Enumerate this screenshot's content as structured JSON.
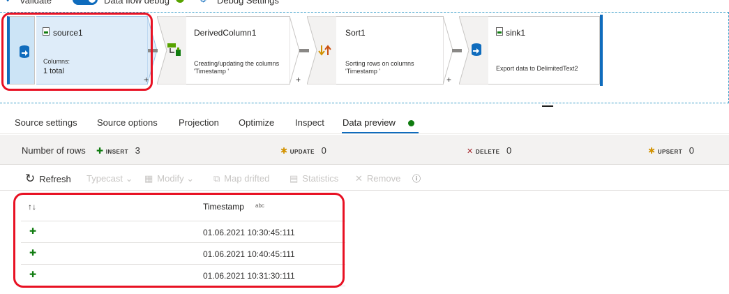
{
  "toolbar": {
    "validate_label": "Validate",
    "dataflow_debug_label": "Data flow debug",
    "debug_settings_label": "Debug Settings"
  },
  "nodes": [
    {
      "title": "source1",
      "desc_line1": "Columns:",
      "desc_line2": "1 total",
      "icon": "source-icon"
    },
    {
      "title": "DerivedColumn1",
      "desc_line1": "Creating/updating the columns",
      "desc_line2": "'Timestamp '",
      "icon": "derived-column-icon"
    },
    {
      "title": "Sort1",
      "desc_line1": "Sorting rows on columns",
      "desc_line2": "'Timestamp '",
      "icon": "sort-icon"
    },
    {
      "title": "sink1",
      "desc_line1": "Export data to DelimitedText2",
      "desc_line2": "",
      "icon": "sink-icon"
    }
  ],
  "plus_symbol": "+",
  "tabs": [
    {
      "label": "Source settings"
    },
    {
      "label": "Source options"
    },
    {
      "label": "Projection"
    },
    {
      "label": "Optimize"
    },
    {
      "label": "Inspect"
    },
    {
      "label": "Data preview",
      "active": true
    }
  ],
  "stats": {
    "rows_label": "Number of rows",
    "insert_label": "INSERT",
    "insert_count": "3",
    "update_label": "UPDATE",
    "update_count": "0",
    "delete_label": "DELETE",
    "delete_count": "0",
    "upsert_label": "UPSERT",
    "upsert_count": "0"
  },
  "actions": {
    "refresh": "Refresh",
    "typecast": "Typecast",
    "modify": "Modify",
    "map_drifted": "Map drifted",
    "statistics": "Statistics",
    "remove": "Remove"
  },
  "table": {
    "column": "Timestamp",
    "column_type": "abc",
    "rows": [
      {
        "timestamp": "01.06.2021 10:30:45:111"
      },
      {
        "timestamp": "01.06.2021 10:40:45:111"
      },
      {
        "timestamp": "01.06.2021 10:31:30:111"
      }
    ]
  },
  "colors": {
    "accent": "#0f6cbd",
    "highlight": "#e81123",
    "insert_green": "#107c10"
  }
}
